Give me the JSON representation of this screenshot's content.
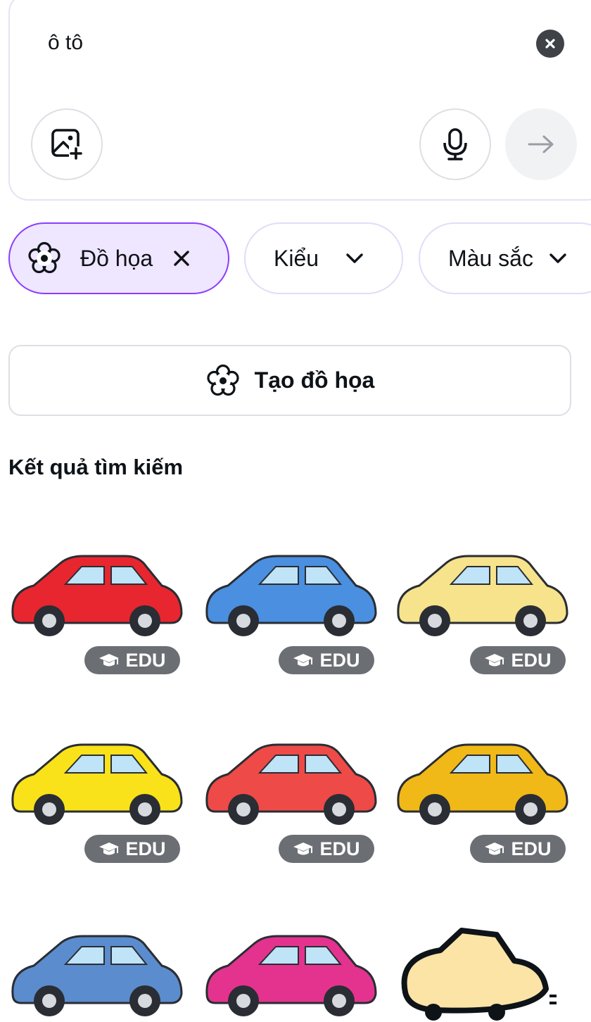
{
  "search": {
    "query": "ô tô",
    "clear_icon": "close-circle-icon",
    "upload_icon": "image-add-icon",
    "mic_icon": "microphone-icon",
    "submit_icon": "arrow-right-icon"
  },
  "filters": [
    {
      "label": "Đồ họa",
      "icon": "flower-icon",
      "active": true,
      "trailing_icon": "close-icon"
    },
    {
      "label": "Kiểu",
      "active": false,
      "trailing_icon": "chevron-down-icon"
    },
    {
      "label": "Màu sắc",
      "active": false,
      "trailing_icon": "chevron-down-icon"
    }
  ],
  "create_button": {
    "label": "Tạo đồ họa",
    "icon": "flower-icon"
  },
  "results": {
    "title": "Kết quả tìm kiếm",
    "items": [
      {
        "name": "red sedan",
        "color": "#e8262f",
        "badge": "EDU"
      },
      {
        "name": "blue beetle",
        "color": "#4a8fe0",
        "badge": "EDU"
      },
      {
        "name": "yellow cartoon car",
        "color": "#f6e38c",
        "badge": "EDU"
      },
      {
        "name": "yellow taxi",
        "color": "#f9e21a",
        "badge": "EDU"
      },
      {
        "name": "red racing car",
        "color": "#ee4a48",
        "badge": "EDU"
      },
      {
        "name": "yellow sports car",
        "color": "#f1b917",
        "badge": "EDU"
      },
      {
        "name": "blue hatchback",
        "color": "#5b8ccd",
        "badge": ""
      },
      {
        "name": "pink hatchback",
        "color": "#e3338f",
        "badge": ""
      },
      {
        "name": "doodle car",
        "color": "#fce4a6",
        "badge": ""
      }
    ]
  },
  "colors": {
    "accent": "#8b3dff",
    "chip_active_bg": "#efe6ff",
    "badge_bg": "#6b6e73"
  }
}
